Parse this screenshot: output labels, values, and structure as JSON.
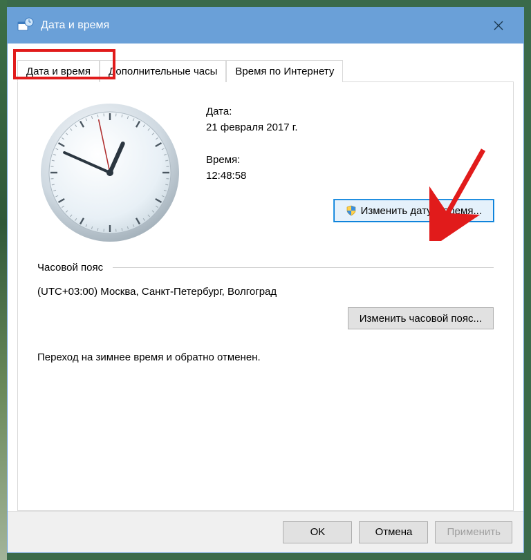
{
  "window": {
    "title": "Дата и время"
  },
  "tabs": {
    "t0": "Дата и время",
    "t1": "Дополнительные часы",
    "t2": "Время по Интернету"
  },
  "panel": {
    "date_label": "Дата:",
    "date_value": "21 февраля 2017 г.",
    "time_label": "Время:",
    "time_value": "12:48:58",
    "change_dt_btn": "Изменить дату и время...",
    "tz_section": "Часовой пояс",
    "tz_value": "(UTC+03:00) Москва, Санкт-Петербург, Волгоград",
    "change_tz_btn": "Изменить часовой пояс...",
    "dst_text": "Переход на зимнее время и обратно отменен."
  },
  "buttons": {
    "ok": "OK",
    "cancel": "Отмена",
    "apply": "Применить"
  },
  "clock": {
    "hour": 12,
    "minute": 48,
    "second": 58
  },
  "colors": {
    "titlebar": "#6aa0d8",
    "highlight": "#e11b1b",
    "focus": "#0078d7"
  }
}
